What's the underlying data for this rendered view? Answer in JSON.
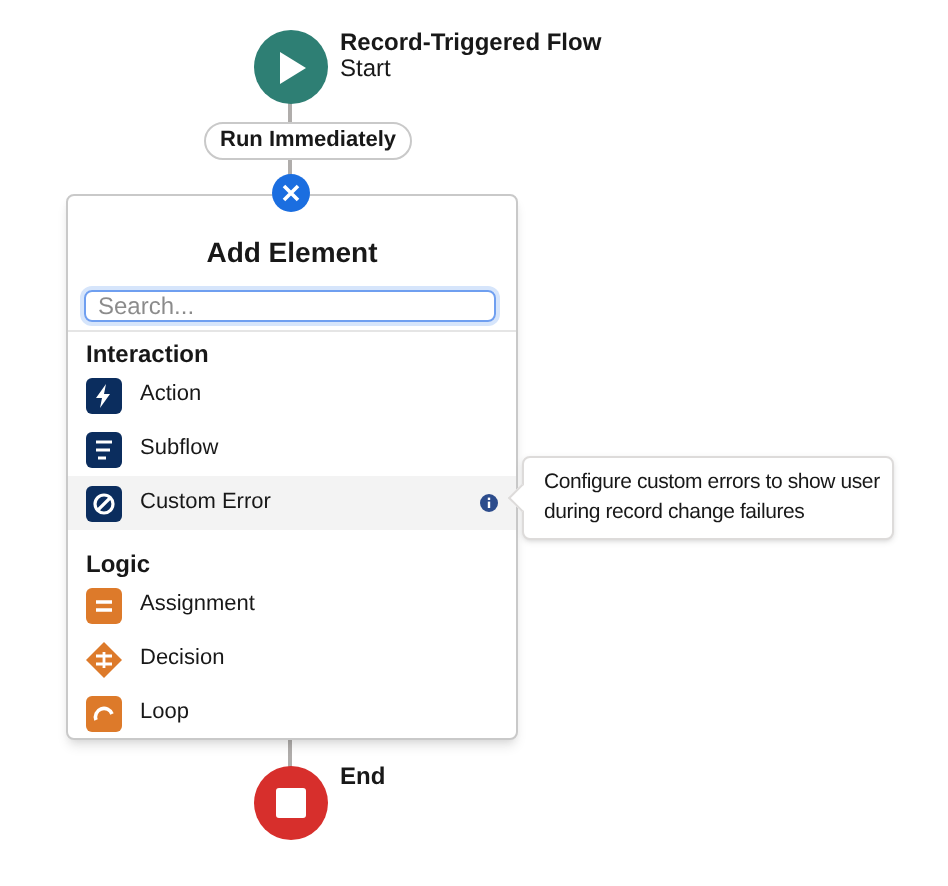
{
  "start": {
    "title": "Record-Triggered Flow",
    "subtitle": "Start"
  },
  "run_label": "Run Immediately",
  "panel": {
    "title": "Add Element",
    "search": {
      "placeholder": "Search..."
    },
    "sections": [
      {
        "heading": "Interaction",
        "items": [
          {
            "label": "Action",
            "kind": "bolt",
            "color": "#0b2d5e",
            "selected": false
          },
          {
            "label": "Subflow",
            "kind": "subflow",
            "color": "#0b2d5e",
            "selected": false
          },
          {
            "label": "Custom Error",
            "kind": "error",
            "color": "#0b2d5e",
            "selected": true
          }
        ]
      },
      {
        "heading": "Logic",
        "items": [
          {
            "label": "Assignment",
            "kind": "assignment",
            "color": "#dd7a2a",
            "selected": false
          },
          {
            "label": "Decision",
            "kind": "decision",
            "color": "#dd7a2a",
            "selected": false
          },
          {
            "label": "Loop",
            "kind": "loop",
            "color": "#dd7a2a",
            "selected": false
          }
        ]
      }
    ]
  },
  "tooltip": "Configure custom errors to show user during record change failures",
  "end": {
    "title": "End"
  }
}
